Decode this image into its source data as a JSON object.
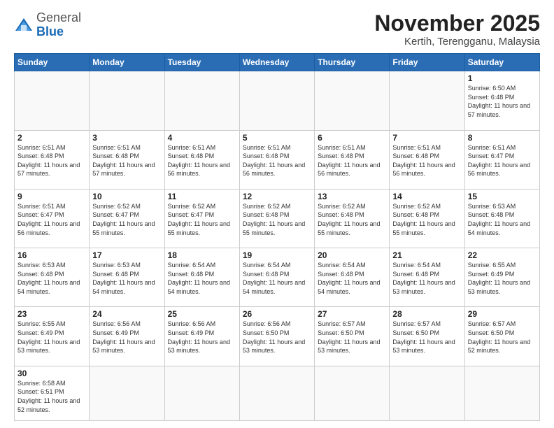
{
  "header": {
    "logo_general": "General",
    "logo_blue": "Blue",
    "month_title": "November 2025",
    "location": "Kertih, Terengganu, Malaysia"
  },
  "weekdays": [
    "Sunday",
    "Monday",
    "Tuesday",
    "Wednesday",
    "Thursday",
    "Friday",
    "Saturday"
  ],
  "weeks": [
    [
      {
        "day": "",
        "info": ""
      },
      {
        "day": "",
        "info": ""
      },
      {
        "day": "",
        "info": ""
      },
      {
        "day": "",
        "info": ""
      },
      {
        "day": "",
        "info": ""
      },
      {
        "day": "",
        "info": ""
      },
      {
        "day": "1",
        "info": "Sunrise: 6:50 AM\nSunset: 6:48 PM\nDaylight: 11 hours\nand 57 minutes."
      }
    ],
    [
      {
        "day": "2",
        "info": "Sunrise: 6:51 AM\nSunset: 6:48 PM\nDaylight: 11 hours\nand 57 minutes."
      },
      {
        "day": "3",
        "info": "Sunrise: 6:51 AM\nSunset: 6:48 PM\nDaylight: 11 hours\nand 57 minutes."
      },
      {
        "day": "4",
        "info": "Sunrise: 6:51 AM\nSunset: 6:48 PM\nDaylight: 11 hours\nand 56 minutes."
      },
      {
        "day": "5",
        "info": "Sunrise: 6:51 AM\nSunset: 6:48 PM\nDaylight: 11 hours\nand 56 minutes."
      },
      {
        "day": "6",
        "info": "Sunrise: 6:51 AM\nSunset: 6:48 PM\nDaylight: 11 hours\nand 56 minutes."
      },
      {
        "day": "7",
        "info": "Sunrise: 6:51 AM\nSunset: 6:48 PM\nDaylight: 11 hours\nand 56 minutes."
      },
      {
        "day": "8",
        "info": "Sunrise: 6:51 AM\nSunset: 6:47 PM\nDaylight: 11 hours\nand 56 minutes."
      }
    ],
    [
      {
        "day": "9",
        "info": "Sunrise: 6:51 AM\nSunset: 6:47 PM\nDaylight: 11 hours\nand 56 minutes."
      },
      {
        "day": "10",
        "info": "Sunrise: 6:52 AM\nSunset: 6:47 PM\nDaylight: 11 hours\nand 55 minutes."
      },
      {
        "day": "11",
        "info": "Sunrise: 6:52 AM\nSunset: 6:47 PM\nDaylight: 11 hours\nand 55 minutes."
      },
      {
        "day": "12",
        "info": "Sunrise: 6:52 AM\nSunset: 6:48 PM\nDaylight: 11 hours\nand 55 minutes."
      },
      {
        "day": "13",
        "info": "Sunrise: 6:52 AM\nSunset: 6:48 PM\nDaylight: 11 hours\nand 55 minutes."
      },
      {
        "day": "14",
        "info": "Sunrise: 6:52 AM\nSunset: 6:48 PM\nDaylight: 11 hours\nand 55 minutes."
      },
      {
        "day": "15",
        "info": "Sunrise: 6:53 AM\nSunset: 6:48 PM\nDaylight: 11 hours\nand 54 minutes."
      }
    ],
    [
      {
        "day": "16",
        "info": "Sunrise: 6:53 AM\nSunset: 6:48 PM\nDaylight: 11 hours\nand 54 minutes."
      },
      {
        "day": "17",
        "info": "Sunrise: 6:53 AM\nSunset: 6:48 PM\nDaylight: 11 hours\nand 54 minutes."
      },
      {
        "day": "18",
        "info": "Sunrise: 6:54 AM\nSunset: 6:48 PM\nDaylight: 11 hours\nand 54 minutes."
      },
      {
        "day": "19",
        "info": "Sunrise: 6:54 AM\nSunset: 6:48 PM\nDaylight: 11 hours\nand 54 minutes."
      },
      {
        "day": "20",
        "info": "Sunrise: 6:54 AM\nSunset: 6:48 PM\nDaylight: 11 hours\nand 54 minutes."
      },
      {
        "day": "21",
        "info": "Sunrise: 6:54 AM\nSunset: 6:48 PM\nDaylight: 11 hours\nand 53 minutes."
      },
      {
        "day": "22",
        "info": "Sunrise: 6:55 AM\nSunset: 6:49 PM\nDaylight: 11 hours\nand 53 minutes."
      }
    ],
    [
      {
        "day": "23",
        "info": "Sunrise: 6:55 AM\nSunset: 6:49 PM\nDaylight: 11 hours\nand 53 minutes."
      },
      {
        "day": "24",
        "info": "Sunrise: 6:56 AM\nSunset: 6:49 PM\nDaylight: 11 hours\nand 53 minutes."
      },
      {
        "day": "25",
        "info": "Sunrise: 6:56 AM\nSunset: 6:49 PM\nDaylight: 11 hours\nand 53 minutes."
      },
      {
        "day": "26",
        "info": "Sunrise: 6:56 AM\nSunset: 6:50 PM\nDaylight: 11 hours\nand 53 minutes."
      },
      {
        "day": "27",
        "info": "Sunrise: 6:57 AM\nSunset: 6:50 PM\nDaylight: 11 hours\nand 53 minutes."
      },
      {
        "day": "28",
        "info": "Sunrise: 6:57 AM\nSunset: 6:50 PM\nDaylight: 11 hours\nand 53 minutes."
      },
      {
        "day": "29",
        "info": "Sunrise: 6:57 AM\nSunset: 6:50 PM\nDaylight: 11 hours\nand 52 minutes."
      }
    ],
    [
      {
        "day": "30",
        "info": "Sunrise: 6:58 AM\nSunset: 6:51 PM\nDaylight: 11 hours\nand 52 minutes."
      },
      {
        "day": "",
        "info": ""
      },
      {
        "day": "",
        "info": ""
      },
      {
        "day": "",
        "info": ""
      },
      {
        "day": "",
        "info": ""
      },
      {
        "day": "",
        "info": ""
      },
      {
        "day": "",
        "info": ""
      }
    ]
  ]
}
